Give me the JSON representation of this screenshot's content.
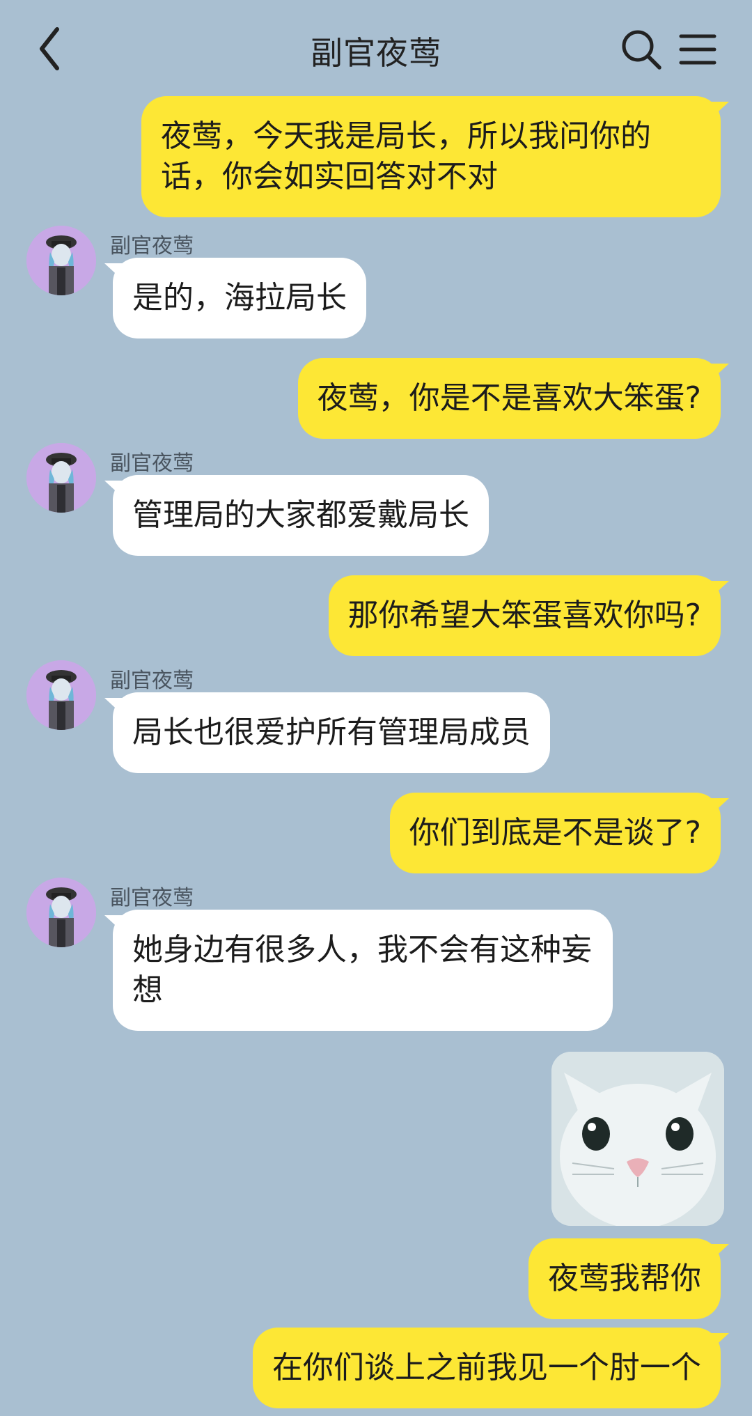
{
  "header": {
    "title": "副官夜莺",
    "back_icon": "chevron-left-icon",
    "search_icon": "search-icon",
    "menu_icon": "menu-icon"
  },
  "colors": {
    "background": "#a9bfd1",
    "outgoing_bubble": "#fde735",
    "incoming_bubble": "#ffffff",
    "avatar_bg": "#c8a8e6"
  },
  "messages": [
    {
      "dir": "out",
      "text": "夜莺，今天我是局长，所以我问你的话，你会如实回答对不对"
    },
    {
      "dir": "in",
      "sender": "副官夜莺",
      "text": "是的，海拉局长"
    },
    {
      "dir": "out",
      "text": "夜莺，你是不是喜欢大笨蛋?"
    },
    {
      "dir": "in",
      "sender": "副官夜莺",
      "text": "管理局的大家都爱戴局长"
    },
    {
      "dir": "out",
      "text": "那你希望大笨蛋喜欢你吗?"
    },
    {
      "dir": "in",
      "sender": "副官夜莺",
      "text": "局长也很爱护所有管理局成员"
    },
    {
      "dir": "out",
      "text": "你们到底是不是谈了?"
    },
    {
      "dir": "in",
      "sender": "副官夜莺",
      "text": "她身边有很多人，我不会有这种妄想"
    },
    {
      "dir": "out",
      "type": "sticker",
      "sticker": "cat-face-sticker"
    },
    {
      "dir": "out",
      "text": "夜莺我帮你"
    },
    {
      "dir": "out",
      "text": "在你们谈上之前我见一个肘一个"
    }
  ]
}
